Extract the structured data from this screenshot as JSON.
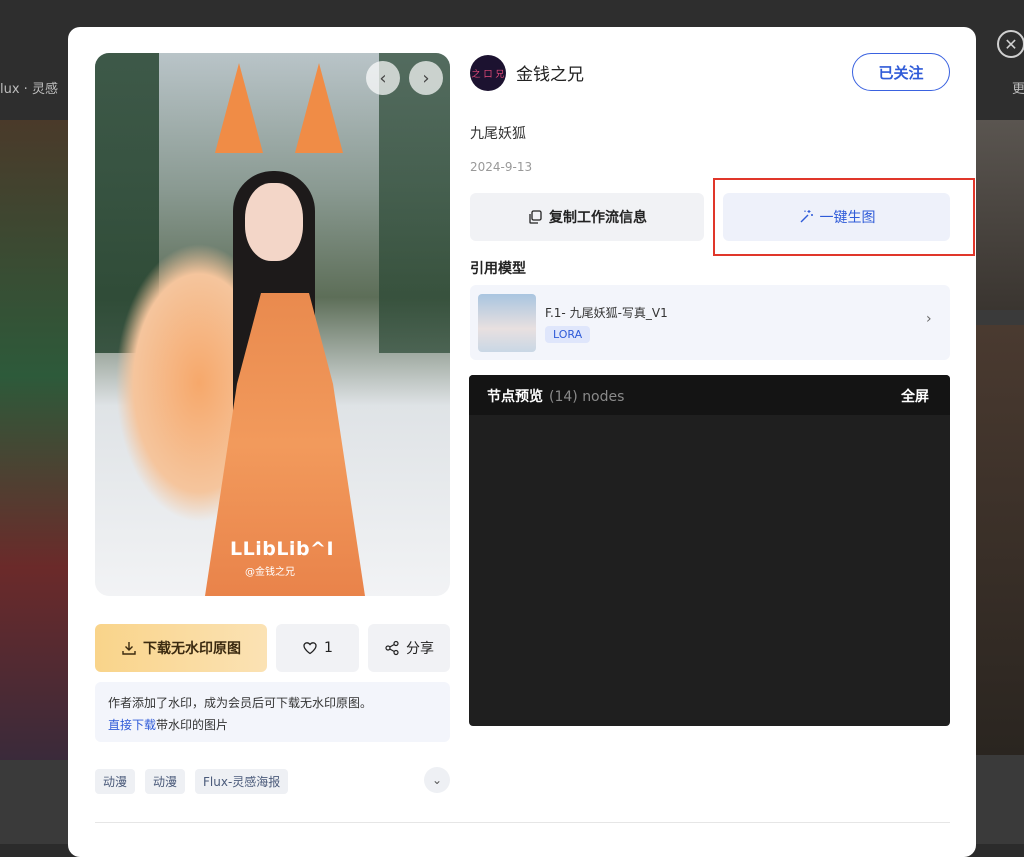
{
  "background": {
    "left_title": "lux · 灵感",
    "right_title": "更"
  },
  "close_icon": "close-icon",
  "hero": {
    "watermark": "LLibLib^I",
    "watermark_sub": "@金钱之兄",
    "prev_icon": "chevron-left-icon",
    "next_icon": "chevron-right-icon"
  },
  "actions": {
    "download_label": "下载无水印原图",
    "like_count": "1",
    "share_label": "分享"
  },
  "notice": {
    "text": "作者添加了水印，成为会员后可下载无水印原图。",
    "link_text": "直接下载",
    "link_suffix": "带水印的图片"
  },
  "tags": [
    "动漫",
    "动漫",
    "Flux-灵感海报"
  ],
  "author": {
    "name": "金钱之兄",
    "avatar_text": "之 口 兄",
    "follow_label": "已关注"
  },
  "work": {
    "title": "九尾妖狐",
    "date": "2024-9-13"
  },
  "buttons": {
    "copy_label": "复制工作流信息",
    "generate_label": "一键生图"
  },
  "reference": {
    "label": "引用模型",
    "model_name": "F.1- 九尾妖狐-写真_V1",
    "model_badge": "LORA"
  },
  "nodes": {
    "title": "节点预览",
    "count": "(14) nodes",
    "fullscreen_label": "全屏"
  },
  "colors": {
    "accent": "#2f5bd8",
    "highlight_red": "#e0362a",
    "download_gold": "#f9d48a"
  }
}
